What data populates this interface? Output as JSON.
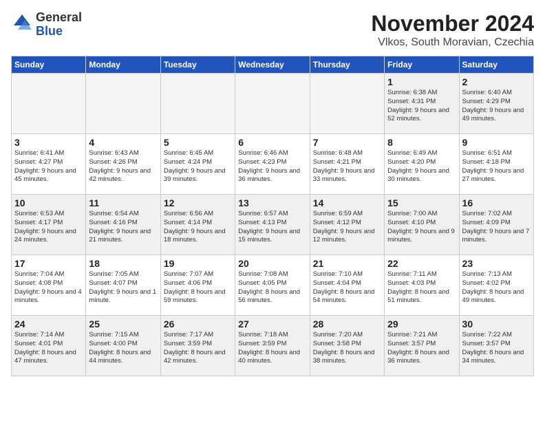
{
  "logo": {
    "line1": "General",
    "line2": "Blue"
  },
  "title": "November 2024",
  "location": "Vlkos, South Moravian, Czechia",
  "days_of_week": [
    "Sunday",
    "Monday",
    "Tuesday",
    "Wednesday",
    "Thursday",
    "Friday",
    "Saturday"
  ],
  "weeks": [
    [
      {
        "day": "",
        "empty": true
      },
      {
        "day": "",
        "empty": true
      },
      {
        "day": "",
        "empty": true
      },
      {
        "day": "",
        "empty": true
      },
      {
        "day": "",
        "empty": true
      },
      {
        "day": "1",
        "sunrise": "6:38 AM",
        "sunset": "4:31 PM",
        "daylight": "9 hours and 52 minutes."
      },
      {
        "day": "2",
        "sunrise": "6:40 AM",
        "sunset": "4:29 PM",
        "daylight": "9 hours and 49 minutes."
      }
    ],
    [
      {
        "day": "3",
        "sunrise": "6:41 AM",
        "sunset": "4:27 PM",
        "daylight": "9 hours and 45 minutes."
      },
      {
        "day": "4",
        "sunrise": "6:43 AM",
        "sunset": "4:26 PM",
        "daylight": "9 hours and 42 minutes."
      },
      {
        "day": "5",
        "sunrise": "6:45 AM",
        "sunset": "4:24 PM",
        "daylight": "9 hours and 39 minutes."
      },
      {
        "day": "6",
        "sunrise": "6:46 AM",
        "sunset": "4:23 PM",
        "daylight": "9 hours and 36 minutes."
      },
      {
        "day": "7",
        "sunrise": "6:48 AM",
        "sunset": "4:21 PM",
        "daylight": "9 hours and 33 minutes."
      },
      {
        "day": "8",
        "sunrise": "6:49 AM",
        "sunset": "4:20 PM",
        "daylight": "9 hours and 30 minutes."
      },
      {
        "day": "9",
        "sunrise": "6:51 AM",
        "sunset": "4:18 PM",
        "daylight": "9 hours and 27 minutes."
      }
    ],
    [
      {
        "day": "10",
        "sunrise": "6:53 AM",
        "sunset": "4:17 PM",
        "daylight": "9 hours and 24 minutes."
      },
      {
        "day": "11",
        "sunrise": "6:54 AM",
        "sunset": "4:16 PM",
        "daylight": "9 hours and 21 minutes."
      },
      {
        "day": "12",
        "sunrise": "6:56 AM",
        "sunset": "4:14 PM",
        "daylight": "9 hours and 18 minutes."
      },
      {
        "day": "13",
        "sunrise": "6:57 AM",
        "sunset": "4:13 PM",
        "daylight": "9 hours and 15 minutes."
      },
      {
        "day": "14",
        "sunrise": "6:59 AM",
        "sunset": "4:12 PM",
        "daylight": "9 hours and 12 minutes."
      },
      {
        "day": "15",
        "sunrise": "7:00 AM",
        "sunset": "4:10 PM",
        "daylight": "9 hours and 9 minutes."
      },
      {
        "day": "16",
        "sunrise": "7:02 AM",
        "sunset": "4:09 PM",
        "daylight": "9 hours and 7 minutes."
      }
    ],
    [
      {
        "day": "17",
        "sunrise": "7:04 AM",
        "sunset": "4:08 PM",
        "daylight": "9 hours and 4 minutes."
      },
      {
        "day": "18",
        "sunrise": "7:05 AM",
        "sunset": "4:07 PM",
        "daylight": "9 hours and 1 minute."
      },
      {
        "day": "19",
        "sunrise": "7:07 AM",
        "sunset": "4:06 PM",
        "daylight": "8 hours and 59 minutes."
      },
      {
        "day": "20",
        "sunrise": "7:08 AM",
        "sunset": "4:05 PM",
        "daylight": "8 hours and 56 minutes."
      },
      {
        "day": "21",
        "sunrise": "7:10 AM",
        "sunset": "4:04 PM",
        "daylight": "8 hours and 54 minutes."
      },
      {
        "day": "22",
        "sunrise": "7:11 AM",
        "sunset": "4:03 PM",
        "daylight": "8 hours and 51 minutes."
      },
      {
        "day": "23",
        "sunrise": "7:13 AM",
        "sunset": "4:02 PM",
        "daylight": "8 hours and 49 minutes."
      }
    ],
    [
      {
        "day": "24",
        "sunrise": "7:14 AM",
        "sunset": "4:01 PM",
        "daylight": "8 hours and 47 minutes."
      },
      {
        "day": "25",
        "sunrise": "7:15 AM",
        "sunset": "4:00 PM",
        "daylight": "8 hours and 44 minutes."
      },
      {
        "day": "26",
        "sunrise": "7:17 AM",
        "sunset": "3:59 PM",
        "daylight": "8 hours and 42 minutes."
      },
      {
        "day": "27",
        "sunrise": "7:18 AM",
        "sunset": "3:59 PM",
        "daylight": "8 hours and 40 minutes."
      },
      {
        "day": "28",
        "sunrise": "7:20 AM",
        "sunset": "3:58 PM",
        "daylight": "8 hours and 38 minutes."
      },
      {
        "day": "29",
        "sunrise": "7:21 AM",
        "sunset": "3:57 PM",
        "daylight": "8 hours and 36 minutes."
      },
      {
        "day": "30",
        "sunrise": "7:22 AM",
        "sunset": "3:57 PM",
        "daylight": "8 hours and 34 minutes."
      }
    ]
  ]
}
